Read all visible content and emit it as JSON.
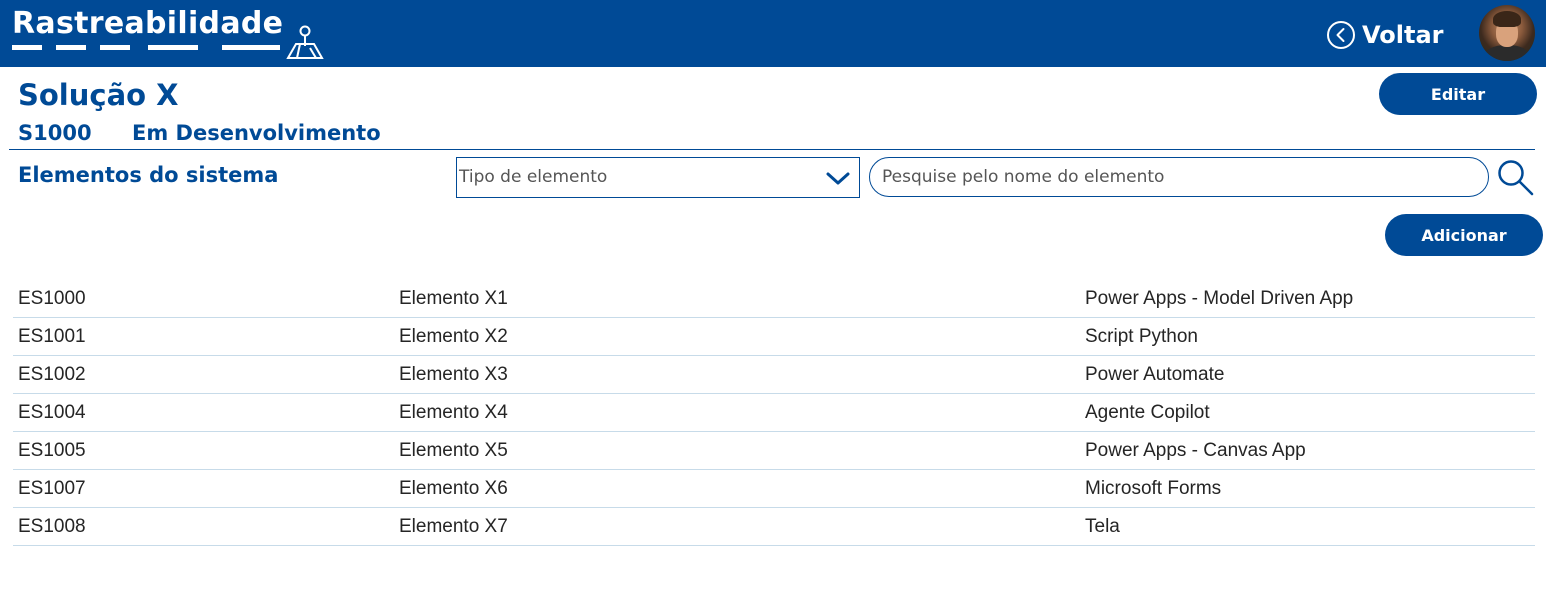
{
  "header": {
    "app_title": "Rastreabilidade",
    "back_label": "Voltar"
  },
  "solution": {
    "name": "Solução X",
    "code": "S1000",
    "status": "Em Desenvolvimento",
    "edit_label": "Editar"
  },
  "elements_section": {
    "title": "Elementos do sistema",
    "type_select": {
      "selected": "Tipo de elemento"
    },
    "search": {
      "placeholder": "Pesquise pelo nome do elemento",
      "value": ""
    },
    "add_label": "Adicionar"
  },
  "elements": [
    {
      "code": "ES1000",
      "name": "Elemento X1",
      "type": "Power Apps - Model Driven App"
    },
    {
      "code": "ES1001",
      "name": "Elemento X2",
      "type": "Script Python"
    },
    {
      "code": "ES1002",
      "name": "Elemento X3",
      "type": "Power Automate"
    },
    {
      "code": "ES1004",
      "name": "Elemento X4",
      "type": "Agente Copilot"
    },
    {
      "code": "ES1005",
      "name": "Elemento X5",
      "type": "Power Apps - Canvas App"
    },
    {
      "code": "ES1007",
      "name": "Elemento X6",
      "type": "Microsoft Forms"
    },
    {
      "code": "ES1008",
      "name": "Elemento X7",
      "type": "Tela"
    }
  ],
  "icons": {
    "brand": "map-pin-icon",
    "back": "chevron-left-circle-icon",
    "select": "chevron-down-icon",
    "search": "search-icon"
  },
  "colors": {
    "primary": "#004a96",
    "row_divider": "#c7dbe9",
    "text": "#252525"
  }
}
